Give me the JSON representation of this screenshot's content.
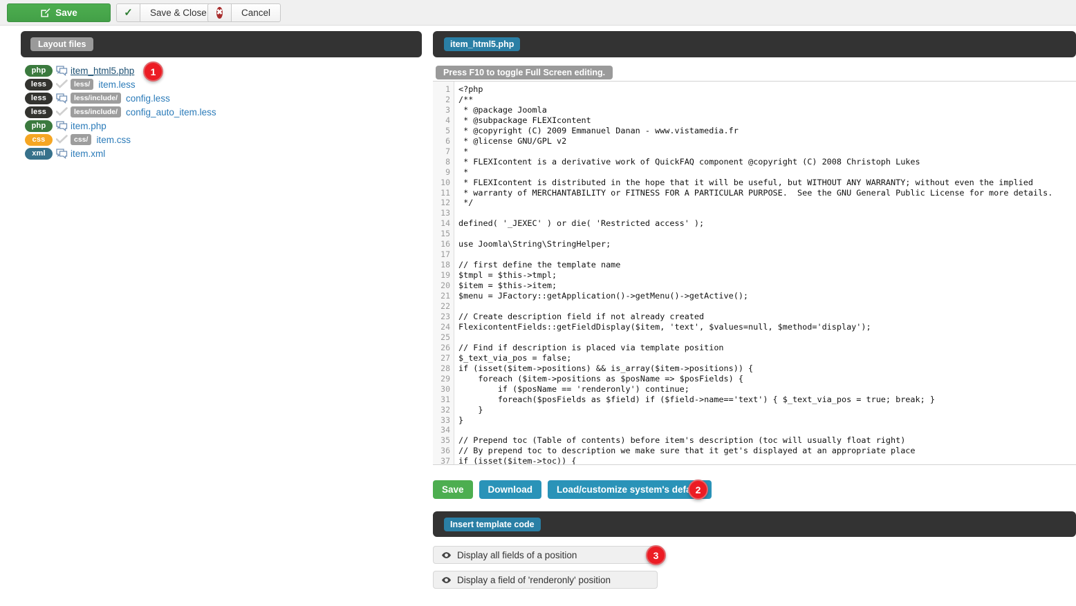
{
  "toolbar": {
    "save_label": "Save",
    "save_close_label": "Save & Close",
    "cancel_label": "Cancel",
    "save_icon": "pencil-square-icon",
    "save_close_icon": "check-icon",
    "cancel_icon": "circle-x-icon"
  },
  "left_panel": {
    "header_label": "Layout files",
    "files": [
      {
        "ext": "php",
        "ext_class": "ext-php",
        "state_icon": "comment-bubble-icon",
        "path": "",
        "name": "item_html5.php",
        "active": true
      },
      {
        "ext": "less",
        "ext_class": "ext-less",
        "state_icon": "check-icon",
        "path": "less/",
        "name": "item.less",
        "active": false
      },
      {
        "ext": "less",
        "ext_class": "ext-less",
        "state_icon": "comment-bubble-icon",
        "path": "less/include/",
        "name": "config.less",
        "active": false
      },
      {
        "ext": "less",
        "ext_class": "ext-less",
        "state_icon": "check-icon",
        "path": "less/include/",
        "name": "config_auto_item.less",
        "active": false
      },
      {
        "ext": "php",
        "ext_class": "ext-php",
        "state_icon": "comment-bubble-icon",
        "path": "",
        "name": "item.php",
        "active": false
      },
      {
        "ext": "css",
        "ext_class": "ext-css",
        "state_icon": "check-icon",
        "path": "css/",
        "name": "item.css",
        "active": false
      },
      {
        "ext": "xml",
        "ext_class": "ext-xml",
        "state_icon": "comment-bubble-icon",
        "path": "",
        "name": "item.xml",
        "active": false
      }
    ]
  },
  "right_panel": {
    "header_label": "item_html5.php",
    "fullscreen_note": "Press F10 to toggle Full Screen editing.",
    "code_lines": [
      "<?php",
      "/**",
      " * @package Joomla",
      " * @subpackage FLEXIcontent",
      " * @copyright (C) 2009 Emmanuel Danan - www.vistamedia.fr",
      " * @license GNU/GPL v2",
      " *",
      " * FLEXIcontent is a derivative work of QuickFAQ component @copyright (C) 2008 Christoph Lukes",
      " *",
      " * FLEXIcontent is distributed in the hope that it will be useful, but WITHOUT ANY WARRANTY; without even the implied",
      " * warranty of MERCHANTABILITY or FITNESS FOR A PARTICULAR PURPOSE.  See the GNU General Public License for more details.",
      " */",
      "",
      "defined( '_JEXEC' ) or die( 'Restricted access' );",
      "",
      "use Joomla\\String\\StringHelper;",
      "",
      "// first define the template name",
      "$tmpl = $this->tmpl;",
      "$item = $this->item;",
      "$menu = JFactory::getApplication()->getMenu()->getActive();",
      "",
      "// Create description field if not already created",
      "FlexicontentFields::getFieldDisplay($item, 'text', $values=null, $method='display');",
      "",
      "// Find if description is placed via template position",
      "$_text_via_pos = false;",
      "if (isset($item->positions) && is_array($item->positions)) {",
      "    foreach ($item->positions as $posName => $posFields) {",
      "        if ($posName == 'renderonly') continue;",
      "        foreach($posFields as $field) if ($field->name=='text') { $_text_via_pos = true; break; }",
      "    }",
      "}",
      "",
      "// Prepend toc (Table of contents) before item's description (toc will usually float right)",
      "// By prepend toc to description we make sure that it get's displayed at an appropriate place",
      "if (isset($item->toc)) {"
    ],
    "actions": [
      {
        "label": "Save",
        "style": "act-green"
      },
      {
        "label": "Download",
        "style": "act-blue"
      },
      {
        "label": "Load/customize system's default",
        "style": "act-blue"
      }
    ],
    "insert_header_label": "Insert template code",
    "display_rows": [
      {
        "label": "Display all fields of a position",
        "icon": "eye-icon"
      },
      {
        "label": "Display a field of 'renderonly' position",
        "icon": "eye-icon"
      }
    ]
  },
  "step_badges": [
    {
      "number": "1"
    },
    {
      "number": "2"
    },
    {
      "number": "3"
    }
  ],
  "colors": {
    "accent_green": "#4dae50",
    "accent_blue": "#2a93b8",
    "dark_panel": "#333333",
    "badge_red": "#ec1c24",
    "link_blue": "#2b7bb9"
  }
}
